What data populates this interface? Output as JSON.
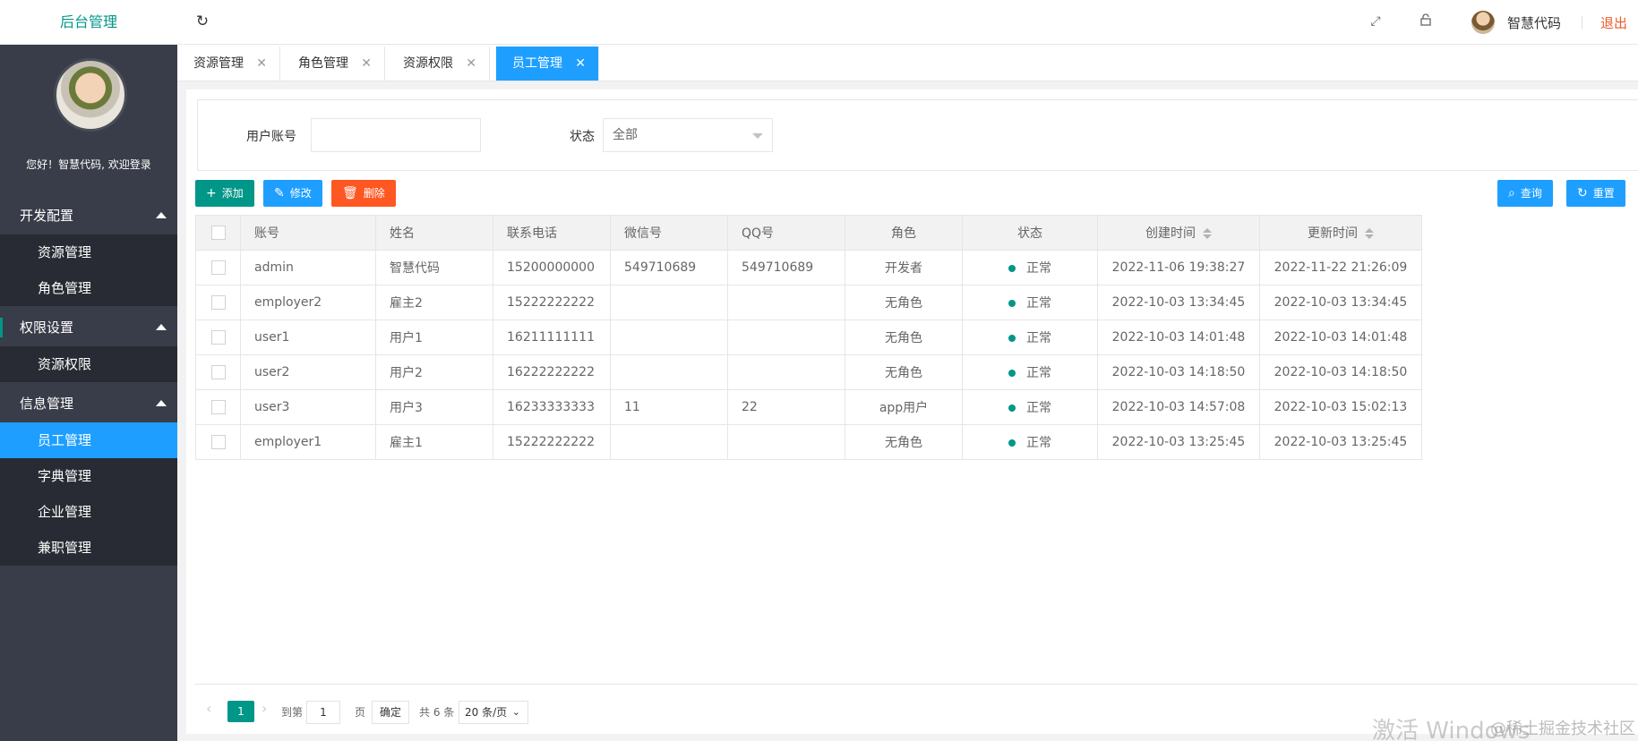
{
  "header": {
    "app_title": "后台管理",
    "user_name": "智慧代码",
    "logout_label": "退出"
  },
  "sidebar": {
    "welcome": "您好！智慧代码, 欢迎登录",
    "groups": [
      {
        "label": "开发配置",
        "items": [
          "资源管理",
          "角色管理"
        ]
      },
      {
        "label": "权限设置",
        "items": [
          "资源权限"
        ]
      },
      {
        "label": "信息管理",
        "items": [
          "员工管理",
          "字典管理",
          "企业管理",
          "兼职管理"
        ]
      }
    ],
    "active_item": "员工管理"
  },
  "tabs": [
    {
      "label": "资源管理",
      "close": "✕"
    },
    {
      "label": "角色管理",
      "close": "✕"
    },
    {
      "label": "资源权限",
      "close": "✕"
    },
    {
      "label": "员工管理",
      "close": "✕",
      "active": true
    }
  ],
  "search": {
    "account_label": "用户账号",
    "account_value": "",
    "status_label": "状态",
    "status_value": "全部"
  },
  "toolbar": {
    "add_label": "添加",
    "edit_label": "修改",
    "delete_label": "删除",
    "query_label": "查询",
    "reset_label": "重置"
  },
  "table": {
    "columns": [
      "账号",
      "姓名",
      "联系电话",
      "微信号",
      "QQ号",
      "角色",
      "状态",
      "创建时间",
      "更新时间"
    ],
    "rows": [
      {
        "account": "admin",
        "name": "智慧代码",
        "phone": "15200000000",
        "wechat": "549710689",
        "qq": "549710689",
        "role": "开发者",
        "status": "正常",
        "created": "2022-11-06 19:38:27",
        "updated": "2022-11-22 21:26:09"
      },
      {
        "account": "employer2",
        "name": "雇主2",
        "phone": "15222222222",
        "wechat": "",
        "qq": "",
        "role": "无角色",
        "status": "正常",
        "created": "2022-10-03 13:34:45",
        "updated": "2022-10-03 13:34:45"
      },
      {
        "account": "user1",
        "name": "用户1",
        "phone": "16211111111",
        "wechat": "",
        "qq": "",
        "role": "无角色",
        "status": "正常",
        "created": "2022-10-03 14:01:48",
        "updated": "2022-10-03 14:01:48"
      },
      {
        "account": "user2",
        "name": "用户2",
        "phone": "16222222222",
        "wechat": "",
        "qq": "",
        "role": "无角色",
        "status": "正常",
        "created": "2022-10-03 14:18:50",
        "updated": "2022-10-03 14:18:50"
      },
      {
        "account": "user3",
        "name": "用户3",
        "phone": "16233333333",
        "wechat": "11",
        "qq": "22",
        "role": "app用户",
        "status": "正常",
        "created": "2022-10-03 14:57:08",
        "updated": "2022-10-03 15:02:13"
      },
      {
        "account": "employer1",
        "name": "雇主1",
        "phone": "15222222222",
        "wechat": "",
        "qq": "",
        "role": "无角色",
        "status": "正常",
        "created": "2022-10-03 13:25:45",
        "updated": "2022-10-03 13:25:45"
      }
    ]
  },
  "pager": {
    "current_page": "1",
    "goto_label": "到第",
    "goto_value": "1",
    "page_unit": "页",
    "confirm_label": "确定",
    "total_label": "共 6 条",
    "page_size": "20 条/页"
  },
  "watermark": {
    "activate": "激活 Windows",
    "source": "@稀土掘金技术社区"
  },
  "colors": {
    "primary": "#009688",
    "blue": "#1e9fff",
    "danger": "#ff5722",
    "sidebar": "#393d49"
  }
}
